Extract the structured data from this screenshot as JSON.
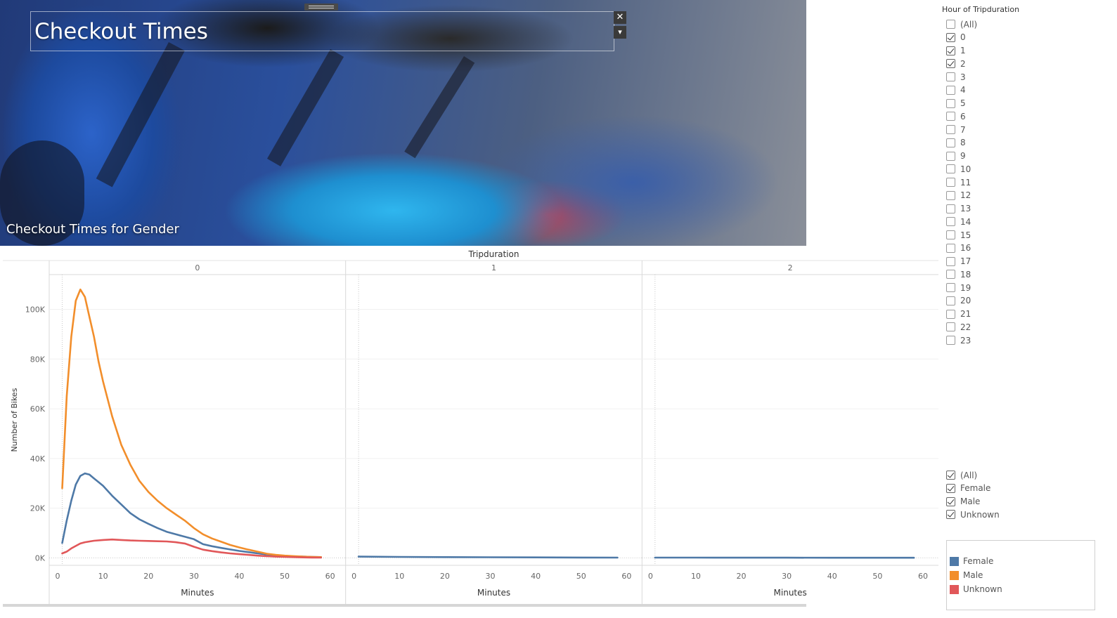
{
  "banner": {
    "title": "Checkout Times",
    "subtitle": "Checkout Times for Gender",
    "close_glyph": "✕",
    "menu_glyph": "▾"
  },
  "filter_hours": {
    "title": "Hour of Tripduration",
    "options": [
      {
        "label": "(All)",
        "checked": false
      },
      {
        "label": "0",
        "checked": true
      },
      {
        "label": "1",
        "checked": true
      },
      {
        "label": "2",
        "checked": true
      },
      {
        "label": "3",
        "checked": false
      },
      {
        "label": "4",
        "checked": false
      },
      {
        "label": "5",
        "checked": false
      },
      {
        "label": "6",
        "checked": false
      },
      {
        "label": "7",
        "checked": false
      },
      {
        "label": "8",
        "checked": false
      },
      {
        "label": "9",
        "checked": false
      },
      {
        "label": "10",
        "checked": false
      },
      {
        "label": "11",
        "checked": false
      },
      {
        "label": "12",
        "checked": false
      },
      {
        "label": "13",
        "checked": false
      },
      {
        "label": "14",
        "checked": false
      },
      {
        "label": "15",
        "checked": false
      },
      {
        "label": "16",
        "checked": false
      },
      {
        "label": "17",
        "checked": false
      },
      {
        "label": "18",
        "checked": false
      },
      {
        "label": "19",
        "checked": false
      },
      {
        "label": "20",
        "checked": false
      },
      {
        "label": "21",
        "checked": false
      },
      {
        "label": "22",
        "checked": false
      },
      {
        "label": "23",
        "checked": false
      }
    ]
  },
  "filter_gender": {
    "options": [
      {
        "label": "(All)",
        "checked": true
      },
      {
        "label": "Female",
        "checked": true
      },
      {
        "label": "Male",
        "checked": true
      },
      {
        "label": "Unknown",
        "checked": true
      }
    ]
  },
  "legend": [
    {
      "label": "Female",
      "color": "#4e79a7"
    },
    {
      "label": "Male",
      "color": "#f28e2b"
    },
    {
      "label": "Unknown",
      "color": "#e15759"
    }
  ],
  "chart_data": {
    "type": "line",
    "title": "Tripduration",
    "xlabel": "Minutes",
    "ylabel": "Number of Bikes",
    "panels": [
      "0",
      "1",
      "2"
    ],
    "xlim": [
      0,
      60
    ],
    "xticks": [
      0,
      10,
      20,
      30,
      40,
      50,
      60
    ],
    "ylim": [
      -3000,
      114000
    ],
    "yticks": [
      0,
      20000,
      40000,
      60000,
      80000,
      100000
    ],
    "ytick_labels": [
      "0K",
      "20K",
      "40K",
      "60K",
      "80K",
      "100K"
    ],
    "grid": true,
    "legend_position": "bottom-right",
    "series": [
      {
        "name": "Female",
        "color": "#4e79a7",
        "panel": "0",
        "x": [
          1,
          2,
          3,
          4,
          5,
          6,
          7,
          8,
          9,
          10,
          12,
          14,
          16,
          18,
          20,
          22,
          24,
          26,
          28,
          30,
          32,
          34,
          36,
          38,
          40,
          42,
          44,
          46,
          48,
          50,
          52,
          54,
          56,
          58
        ],
        "values": [
          6000,
          15000,
          23000,
          29500,
          33000,
          34000,
          33500,
          32000,
          30500,
          29000,
          25000,
          21500,
          18000,
          15500,
          13700,
          12000,
          10500,
          9500,
          8500,
          7500,
          5500,
          4700,
          4000,
          3400,
          2800,
          2300,
          1800,
          1400,
          1000,
          800,
          600,
          500,
          400,
          300
        ]
      },
      {
        "name": "Male",
        "color": "#f28e2b",
        "panel": "0",
        "x": [
          1,
          2,
          3,
          4,
          5,
          6,
          7,
          8,
          9,
          10,
          12,
          14,
          16,
          18,
          20,
          22,
          24,
          26,
          28,
          30,
          32,
          34,
          36,
          38,
          40,
          42,
          44,
          46,
          48,
          50,
          52,
          54,
          56,
          58
        ],
        "values": [
          28000,
          65000,
          89000,
          103500,
          108000,
          105000,
          97000,
          89000,
          79000,
          71000,
          57000,
          45500,
          37500,
          31000,
          26500,
          23000,
          20000,
          17500,
          15000,
          12000,
          9500,
          7800,
          6500,
          5200,
          4200,
          3300,
          2500,
          1700,
          1200,
          900,
          700,
          500,
          400,
          300
        ]
      },
      {
        "name": "Unknown",
        "color": "#e15759",
        "panel": "0",
        "x": [
          1,
          2,
          3,
          4,
          5,
          6,
          8,
          10,
          12,
          14,
          16,
          18,
          20,
          22,
          24,
          26,
          28,
          30,
          32,
          34,
          36,
          38,
          40,
          42,
          44,
          46,
          48,
          50,
          52,
          54,
          56,
          58
        ],
        "values": [
          1800,
          2500,
          3800,
          4800,
          5800,
          6300,
          6900,
          7200,
          7400,
          7200,
          7000,
          6900,
          6800,
          6700,
          6600,
          6300,
          5800,
          4500,
          3300,
          2700,
          2200,
          1800,
          1500,
          1200,
          900,
          700,
          500,
          400,
          300,
          200,
          150,
          100
        ]
      },
      {
        "name": "Female",
        "color": "#4e79a7",
        "panel": "1",
        "x": [
          1,
          10,
          20,
          30,
          40,
          50,
          58
        ],
        "values": [
          500,
          400,
          300,
          250,
          200,
          150,
          100
        ]
      },
      {
        "name": "Female",
        "color": "#4e79a7",
        "panel": "2",
        "x": [
          1,
          10,
          20,
          30,
          40,
          50,
          58
        ],
        "values": [
          100,
          100,
          80,
          80,
          60,
          60,
          50
        ]
      }
    ]
  }
}
